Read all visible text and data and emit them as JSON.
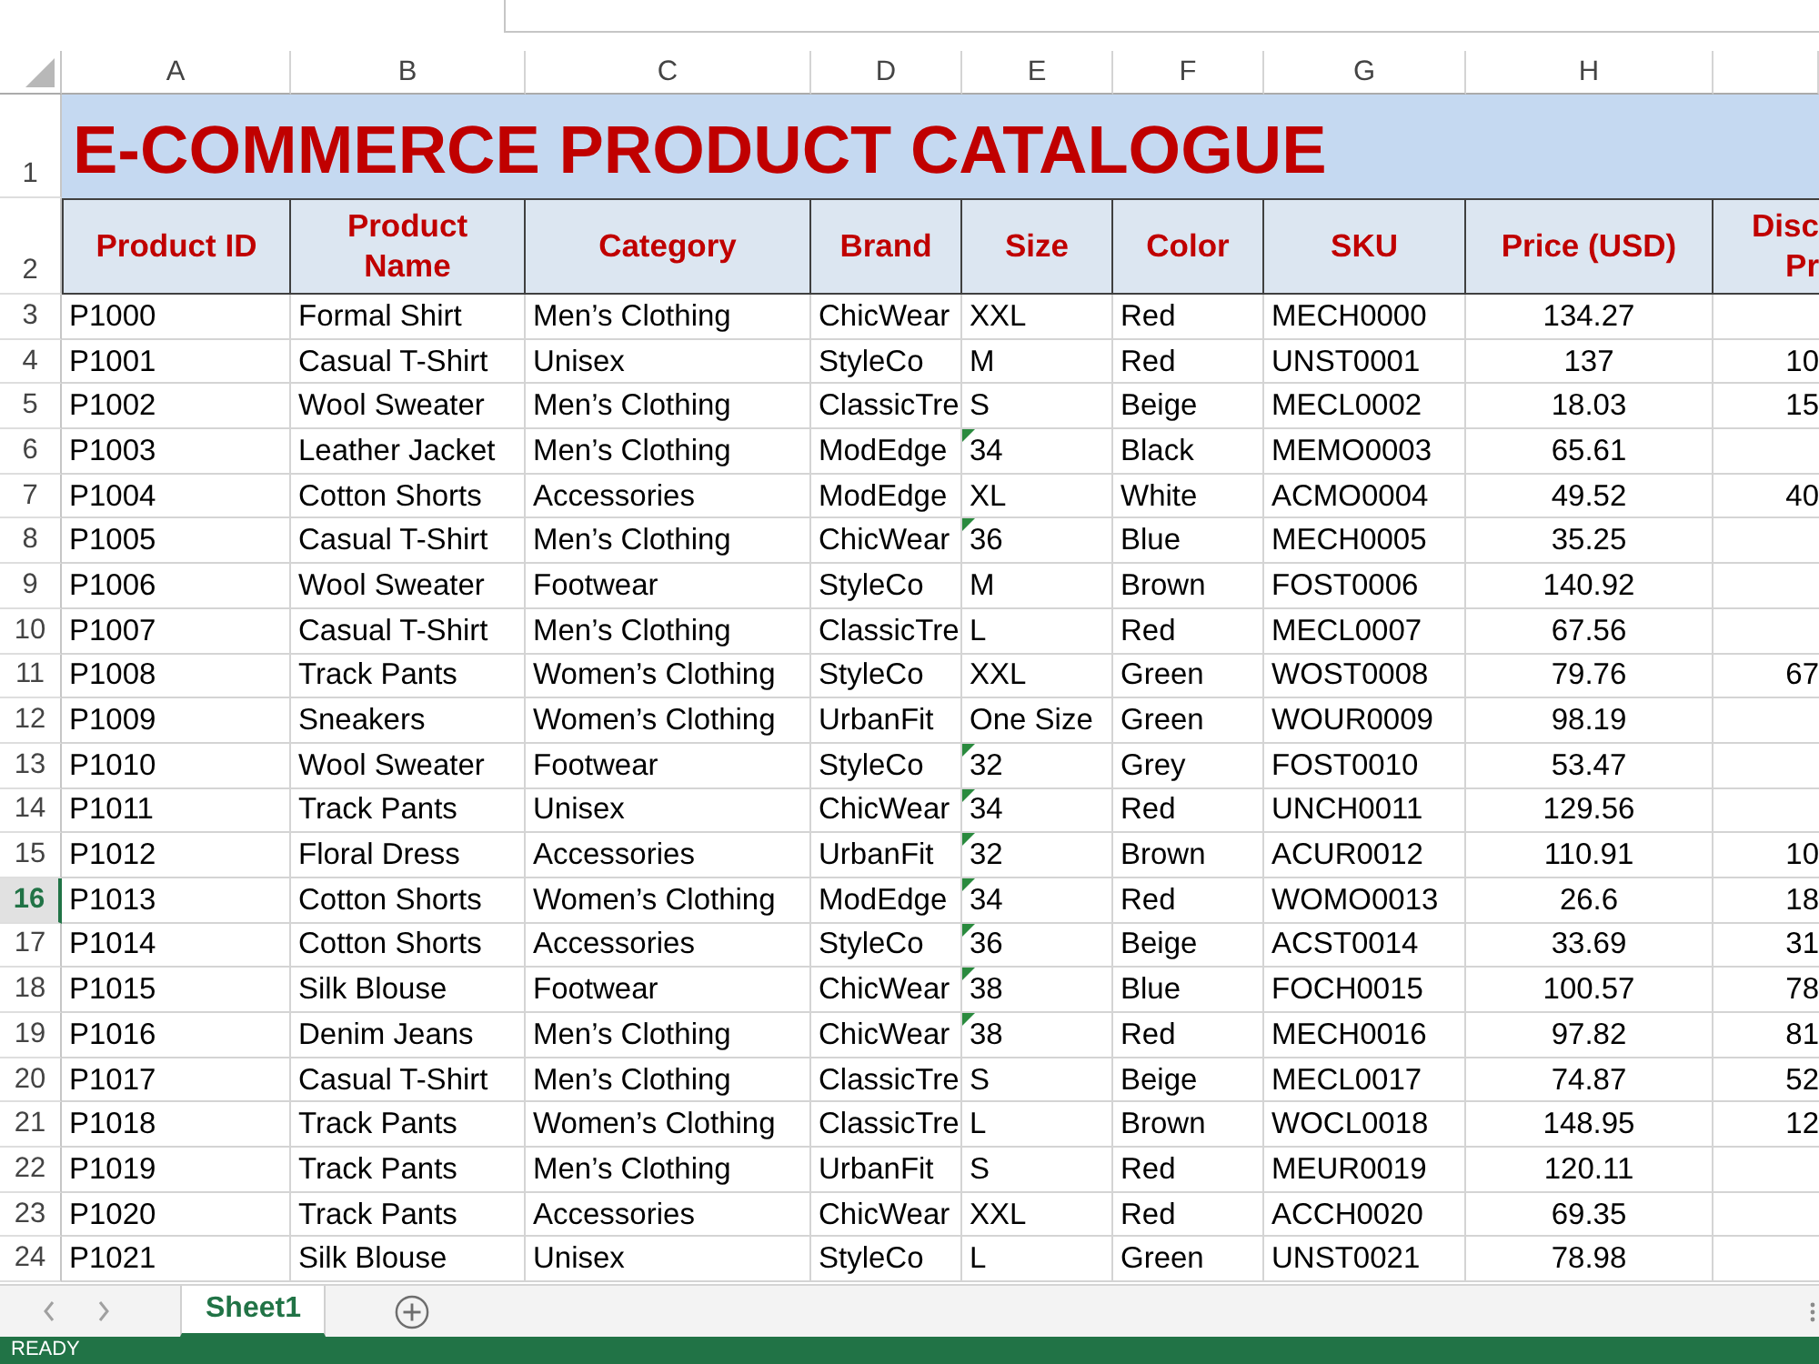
{
  "column_letters": [
    "A",
    "B",
    "C",
    "D",
    "E",
    "F",
    "G",
    "H"
  ],
  "title_row": {
    "row_number": "1",
    "text": "E-COMMERCE PRODUCT CATALOGUE"
  },
  "header_row": {
    "row_number": "2",
    "labels": [
      "Product ID",
      "Product Name",
      "Category",
      "Brand",
      "Size",
      "Color",
      "SKU",
      "Price (USD)",
      "Disc Pr"
    ]
  },
  "rows": [
    {
      "row_number": "3",
      "selected": false,
      "size_flag": false,
      "cells": [
        "P1000",
        "Formal Shirt",
        "Men’s Clothing",
        "ChicWear",
        "XXL",
        "Red",
        "MECH0000",
        "134.27"
      ]
    },
    {
      "row_number": "4",
      "selected": false,
      "size_flag": false,
      "cells": [
        "P1001",
        "Casual T-Shirt",
        "Unisex",
        "StyleCo",
        "M",
        "Red",
        "UNST0001",
        "137",
        "10"
      ]
    },
    {
      "row_number": "5",
      "selected": false,
      "size_flag": false,
      "cells": [
        "P1002",
        "Wool Sweater",
        "Men’s Clothing",
        "ClassicTre",
        "S",
        "Beige",
        "MECL0002",
        "18.03",
        "15"
      ]
    },
    {
      "row_number": "6",
      "selected": false,
      "size_flag": true,
      "cells": [
        "P1003",
        "Leather Jacket",
        "Men’s Clothing",
        "ModEdge",
        "34",
        "Black",
        "MEMO0003",
        "65.61"
      ]
    },
    {
      "row_number": "7",
      "selected": false,
      "size_flag": false,
      "cells": [
        "P1004",
        "Cotton Shorts",
        "Accessories",
        "ModEdge",
        "XL",
        "White",
        "ACMO0004",
        "49.52",
        "40"
      ]
    },
    {
      "row_number": "8",
      "selected": false,
      "size_flag": true,
      "cells": [
        "P1005",
        "Casual T-Shirt",
        "Men’s Clothing",
        "ChicWear",
        "36",
        "Blue",
        "MECH0005",
        "35.25"
      ]
    },
    {
      "row_number": "9",
      "selected": false,
      "size_flag": false,
      "cells": [
        "P1006",
        "Wool Sweater",
        "Footwear",
        "StyleCo",
        "M",
        "Brown",
        "FOST0006",
        "140.92"
      ]
    },
    {
      "row_number": "10",
      "selected": false,
      "size_flag": false,
      "cells": [
        "P1007",
        "Casual T-Shirt",
        "Men’s Clothing",
        "ClassicTre",
        "L",
        "Red",
        "MECL0007",
        "67.56"
      ]
    },
    {
      "row_number": "11",
      "selected": false,
      "size_flag": false,
      "cells": [
        "P1008",
        "Track Pants",
        "Women’s Clothing",
        "StyleCo",
        "XXL",
        "Green",
        "WOST0008",
        "79.76",
        "67"
      ]
    },
    {
      "row_number": "12",
      "selected": false,
      "size_flag": false,
      "cells": [
        "P1009",
        "Sneakers",
        "Women’s Clothing",
        "UrbanFit",
        "One Size",
        "Green",
        "WOUR0009",
        "98.19"
      ]
    },
    {
      "row_number": "13",
      "selected": false,
      "size_flag": true,
      "cells": [
        "P1010",
        "Wool Sweater",
        "Footwear",
        "StyleCo",
        "32",
        "Grey",
        "FOST0010",
        "53.47"
      ]
    },
    {
      "row_number": "14",
      "selected": false,
      "size_flag": true,
      "cells": [
        "P1011",
        "Track Pants",
        "Unisex",
        "ChicWear",
        "34",
        "Red",
        "UNCH0011",
        "129.56"
      ]
    },
    {
      "row_number": "15",
      "selected": false,
      "size_flag": true,
      "cells": [
        "P1012",
        "Floral Dress",
        "Accessories",
        "UrbanFit",
        "32",
        "Brown",
        "ACUR0012",
        "110.91",
        "10"
      ]
    },
    {
      "row_number": "16",
      "selected": true,
      "size_flag": true,
      "cells": [
        "P1013",
        "Cotton Shorts",
        "Women’s Clothing",
        "ModEdge",
        "34",
        "Red",
        "WOMO0013",
        "26.6",
        "18"
      ]
    },
    {
      "row_number": "17",
      "selected": false,
      "size_flag": true,
      "cells": [
        "P1014",
        "Cotton Shorts",
        "Accessories",
        "StyleCo",
        "36",
        "Beige",
        "ACST0014",
        "33.69",
        "31"
      ]
    },
    {
      "row_number": "18",
      "selected": false,
      "size_flag": true,
      "cells": [
        "P1015",
        "Silk Blouse",
        "Footwear",
        "ChicWear",
        "38",
        "Blue",
        "FOCH0015",
        "100.57",
        "78"
      ]
    },
    {
      "row_number": "19",
      "selected": false,
      "size_flag": true,
      "cells": [
        "P1016",
        "Denim Jeans",
        "Men’s Clothing",
        "ChicWear",
        "38",
        "Red",
        "MECH0016",
        "97.82",
        "81"
      ]
    },
    {
      "row_number": "20",
      "selected": false,
      "size_flag": false,
      "cells": [
        "P1017",
        "Casual T-Shirt",
        "Men’s Clothing",
        "ClassicTre",
        "S",
        "Beige",
        "MECL0017",
        "74.87",
        "52"
      ]
    },
    {
      "row_number": "21",
      "selected": false,
      "size_flag": false,
      "cells": [
        "P1018",
        "Track Pants",
        "Women’s Clothing",
        "ClassicTre",
        "L",
        "Brown",
        "WOCL0018",
        "148.95",
        "12"
      ]
    },
    {
      "row_number": "22",
      "selected": false,
      "size_flag": false,
      "cells": [
        "P1019",
        "Track Pants",
        "Men’s Clothing",
        "UrbanFit",
        "S",
        "Red",
        "MEUR0019",
        "120.11"
      ]
    },
    {
      "row_number": "23",
      "selected": false,
      "size_flag": false,
      "cells": [
        "P1020",
        "Track Pants",
        "Accessories",
        "ChicWear",
        "XXL",
        "Red",
        "ACCH0020",
        "69.35"
      ]
    },
    {
      "row_number": "24",
      "selected": false,
      "size_flag": false,
      "cells": [
        "P1021",
        "Silk Blouse",
        "Unisex",
        "StyleCo",
        "L",
        "Green",
        "UNST0021",
        "78.98"
      ]
    }
  ],
  "sheet_tabs": [
    {
      "label": "Sheet1",
      "selected": true
    }
  ],
  "status_bar": {
    "text": "READY"
  }
}
